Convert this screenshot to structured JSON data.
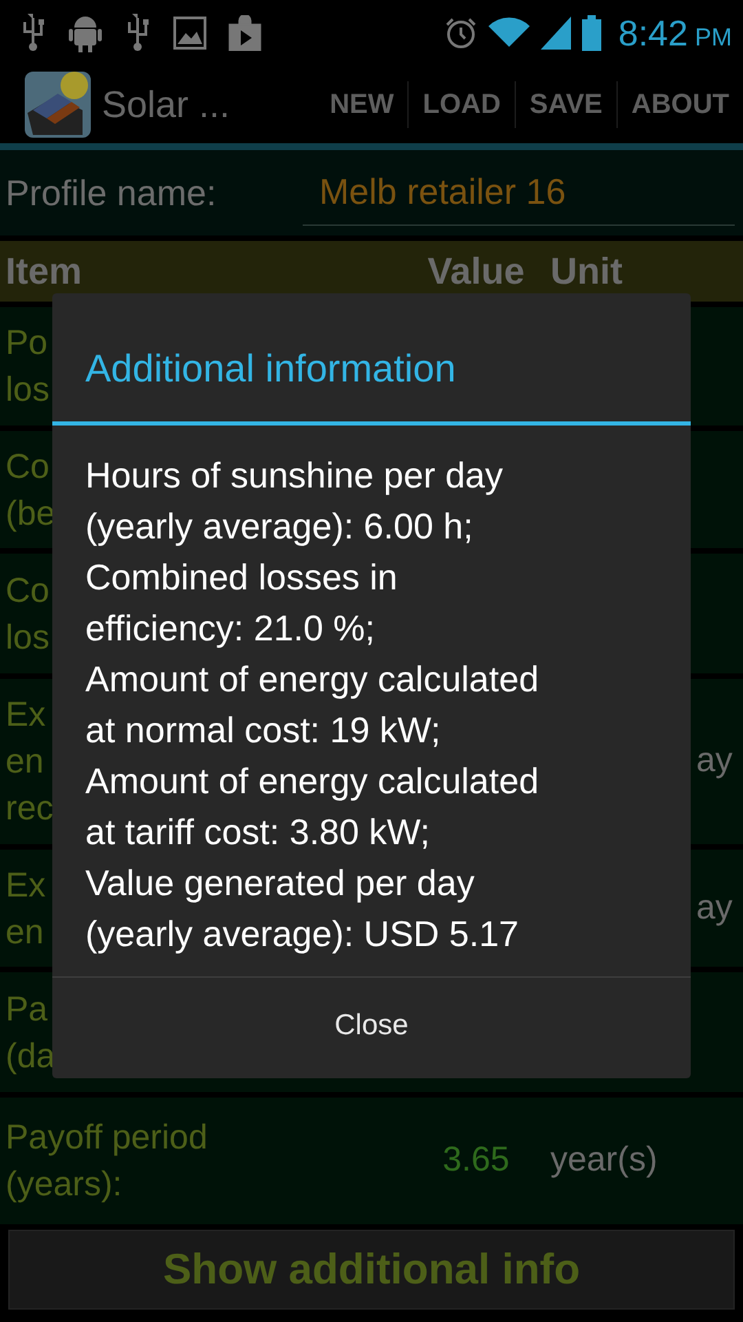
{
  "status_bar": {
    "time": "8:42",
    "ampm": "PM"
  },
  "action_bar": {
    "title": "Solar ...",
    "actions": [
      "NEW",
      "LOAD",
      "SAVE",
      "ABOUT"
    ]
  },
  "profile": {
    "label": "Profile name:",
    "value": "Melb retailer 16"
  },
  "table": {
    "columns": [
      "Item",
      "Value",
      "Unit"
    ],
    "rows": [
      {
        "item": [
          "Po",
          "los"
        ]
      },
      {
        "item": [
          "Co",
          "(be"
        ]
      },
      {
        "item": [
          "Co",
          "los"
        ]
      },
      {
        "item": [
          "Ex",
          "en",
          "rec"
        ],
        "unit": "ay"
      },
      {
        "item": [
          "Ex",
          "en"
        ],
        "unit": "ay"
      },
      {
        "item": [
          "Pa",
          "(da"
        ]
      },
      {
        "item": [
          "Payoff period",
          "(years):"
        ],
        "value": "3.65",
        "unit": "year(s)"
      }
    ]
  },
  "dialog": {
    "title": "Additional information",
    "lines": [
      "Hours of sunshine per day",
      "(yearly average): 6.00 h;",
      "Combined losses in",
      "efficiency: 21.0 %;",
      "Amount of energy calculated",
      "at normal cost: 19 kW;",
      "Amount of energy calculated",
      "at tariff cost: 3.80 kW;",
      "Value generated per day",
      "(yearly average): USD 5.17"
    ],
    "button": "Close"
  },
  "bottom_button": "Show additional info"
}
